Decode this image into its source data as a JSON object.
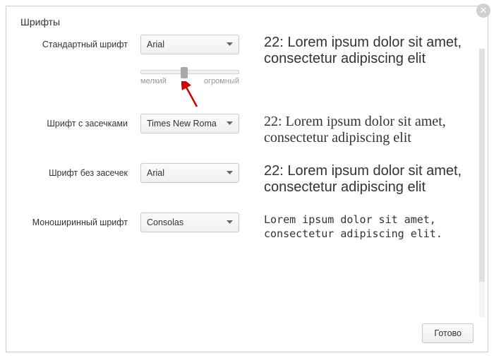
{
  "header": {
    "title": "Шрифты"
  },
  "rows": {
    "standard": {
      "label": "Стандартный шрифт",
      "value": "Arial",
      "preview": "22: Lorem ipsum dolor sit amet, consectetur adipiscing elit"
    },
    "serif": {
      "label": "Шрифт с засечками",
      "value": "Times New Roma",
      "preview": "22: Lorem ipsum dolor sit amet, consectetur adipiscing elit"
    },
    "sans": {
      "label": "Шрифт без засечек",
      "value": "Arial",
      "preview": "22: Lorem ipsum dolor sit amet, consectetur adipiscing elit"
    },
    "mono": {
      "label": "Моноширинный шрифт",
      "value": "Consolas",
      "preview": "Lorem ipsum dolor sit amet, consectetur adipiscing elit."
    }
  },
  "slider": {
    "min_label": "мелкий",
    "max_label": "огромный"
  },
  "footer": {
    "done": "Готово"
  }
}
